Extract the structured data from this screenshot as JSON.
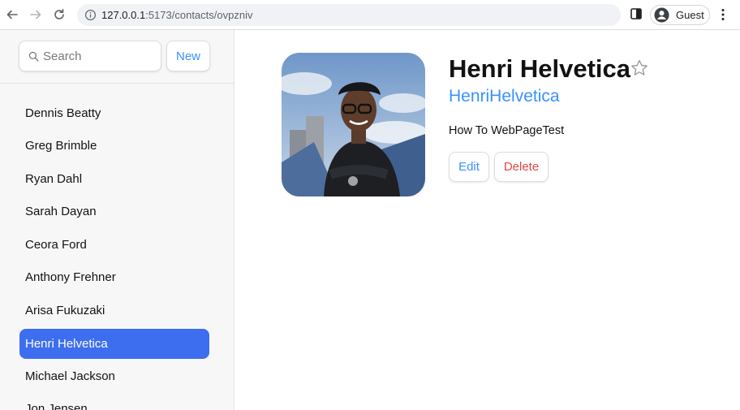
{
  "browser": {
    "url_host": "127.0.0.1",
    "url_path": ":5173/contacts/ovpzniv",
    "profile_label": "Guest"
  },
  "sidebar": {
    "search_placeholder": "Search",
    "new_label": "New",
    "contacts": [
      {
        "name": "Dennis Beatty"
      },
      {
        "name": "Greg Brimble"
      },
      {
        "name": "Ryan Dahl"
      },
      {
        "name": "Sarah Dayan"
      },
      {
        "name": "Ceora Ford"
      },
      {
        "name": "Anthony Frehner"
      },
      {
        "name": "Arisa Fukuzaki"
      },
      {
        "name": "Henri Helvetica"
      },
      {
        "name": "Michael Jackson"
      },
      {
        "name": "Jon Jensen"
      }
    ],
    "active_contact": "Henri Helvetica"
  },
  "contact": {
    "name": "Henri Helvetica",
    "twitter": "HenriHelvetica",
    "notes": "How To WebPageTest",
    "favorite": false,
    "edit_label": "Edit",
    "delete_label": "Delete"
  },
  "colors": {
    "accent": "#3992ff",
    "active_item": "#3e6ef0",
    "danger": "#e04848"
  }
}
